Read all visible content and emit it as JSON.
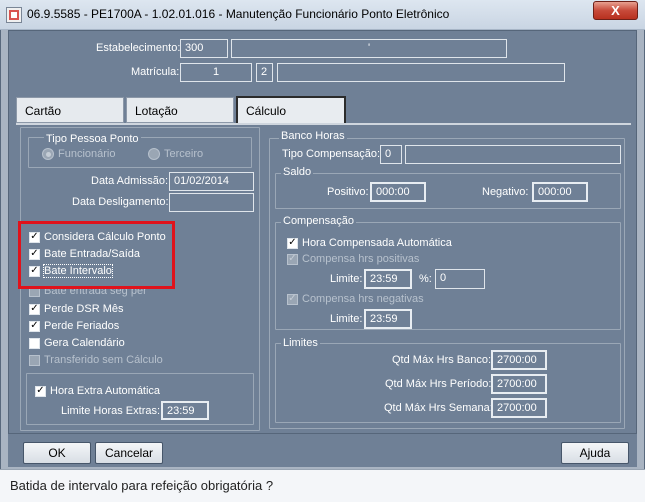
{
  "window": {
    "title": "06.9.5585 - PE1700A - 1.02.01.016 - Manutenção Funcionário Ponto Eletrônico",
    "close_label": "X"
  },
  "header": {
    "estabelecimento_label": "Estabelecimento:",
    "estabelecimento_value": "300",
    "estabelecimento_desc": "'",
    "matricula_label": "Matrícula:",
    "matricula_value": "1",
    "matricula_digit": "2",
    "matricula_desc": ""
  },
  "tabs": [
    {
      "label": "Cartão"
    },
    {
      "label": "Lotação"
    },
    {
      "label": "Cálculo"
    }
  ],
  "tipo_pessoa": {
    "title": "Tipo Pessoa Ponto",
    "opt1": "Funcionário",
    "opt2": "Terceiro"
  },
  "datas": {
    "admissao_label": "Data Admissão:",
    "admissao_value": "01/02/2014",
    "desligamento_label": "Data Desligamento:",
    "desligamento_value": ""
  },
  "checks": [
    {
      "label": "Considera Cálculo Ponto",
      "checked": true,
      "enabled": true
    },
    {
      "label": "Bate Entrada/Saída",
      "checked": true,
      "enabled": true
    },
    {
      "label": "Bate Intervalo",
      "checked": true,
      "enabled": true
    },
    {
      "label": "Bate entrada seg per",
      "checked": false,
      "enabled": false
    },
    {
      "label": "Perde DSR Mês",
      "checked": true,
      "enabled": true
    },
    {
      "label": "Perde Feriados",
      "checked": true,
      "enabled": true
    },
    {
      "label": "Gera Calendário",
      "checked": false,
      "enabled": true
    },
    {
      "label": "Transferido sem Cálculo",
      "checked": false,
      "enabled": false
    }
  ],
  "hora_extra": {
    "auto_label": "Hora Extra Automática",
    "limite_label": "Limite Horas Extras:",
    "limite_value": "23:59"
  },
  "banco_horas": {
    "title": "Banco Horas",
    "tipo_label": "Tipo Compensação:",
    "tipo_value": "0",
    "tipo_desc": ""
  },
  "saldo": {
    "title": "Saldo",
    "positivo_label": "Positivo:",
    "positivo_value": "000:00",
    "negativo_label": "Negativo:",
    "negativo_value": "000:00"
  },
  "compensacao": {
    "title": "Compensação",
    "auto_label": "Hora Compensada Automática",
    "positivas_label": "Compensa hrs positivas",
    "limite_label": "Limite:",
    "limite1_value": "23:59",
    "pct_label": "%:",
    "pct_value": "0",
    "negativas_label": "Compensa hrs negativas",
    "limite2_value": "23:59"
  },
  "limites": {
    "title": "Limites",
    "banco_label": "Qtd Máx Hrs Banco:",
    "banco_value": "2700:00",
    "periodo_label": "Qtd Máx Hrs Período:",
    "periodo_value": "2700:00",
    "semana_label": "Qtd Máx Hrs Semana:",
    "semana_value": "2700:00"
  },
  "buttons": {
    "ok": "OK",
    "cancelar": "Cancelar",
    "ajuda": "Ajuda"
  },
  "status": "Batida de intervalo para refeição obrigatória ?"
}
